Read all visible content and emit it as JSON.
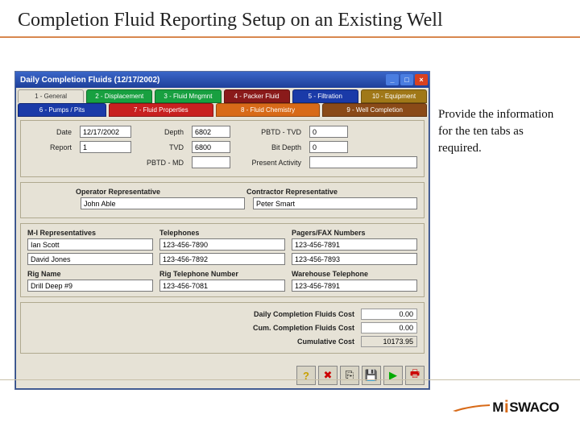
{
  "slide": {
    "title": "Completion Fluid Reporting Setup on an Existing Well"
  },
  "callout": {
    "text": "Provide the information for the ten tabs as required."
  },
  "window": {
    "title": "Daily Completion Fluids (12/17/2002)"
  },
  "tabs": {
    "row1": [
      {
        "label": "1 - General",
        "active": true
      },
      {
        "label": "2 - Displacement"
      },
      {
        "label": "3 - Fluid Mngmnt"
      },
      {
        "label": "4 - Packer Fluid"
      },
      {
        "label": "5 - Filtration"
      },
      {
        "label": "10 - Equipment"
      }
    ],
    "row2": [
      {
        "label": "6 - Pumps / Pits"
      },
      {
        "label": "7 - Fluid Properties"
      },
      {
        "label": "8 - Fluid Chemistry"
      },
      {
        "label": "9 - Well Completion"
      }
    ]
  },
  "general": {
    "date_label": "Date",
    "date": "12/17/2002",
    "report_label": "Report",
    "report": "1",
    "depth_label": "Depth",
    "depth": "6802",
    "tvd_label": "TVD",
    "tvd": "6800",
    "pbtd_md_label": "PBTD - MD",
    "pbtd_md": "",
    "pbtd_tvd_label": "PBTD - TVD",
    "pbtd_tvd": "0",
    "bit_depth_label": "Bit Depth",
    "bit_depth": "0",
    "activity_label": "Present Activity",
    "activity": ""
  },
  "reps": {
    "op_label": "Operator Representative",
    "op": "John Able",
    "con_label": "Contractor Representative",
    "con": "Peter Smart"
  },
  "contacts": {
    "mi_label": "M-I Representatives",
    "tel_label": "Telephones",
    "fax_label": "Pagers/FAX Numbers",
    "mi1": "Ian Scott",
    "tel1": "123-456-7890",
    "fax1": "123-456-7891",
    "mi2": "David Jones",
    "tel2": "123-456-7892",
    "fax2": "123-456-7893",
    "rig_label": "Rig Name",
    "rigtel_label": "Rig Telephone Number",
    "wh_label": "Warehouse Telephone",
    "rig": "Drill Deep #9",
    "rigtel": "123-456-7081",
    "wh": "123-456-7891"
  },
  "summary": {
    "daily_label": "Daily Completion Fluids Cost",
    "daily": "0.00",
    "cum_label": "Cum. Completion Fluids Cost",
    "cum": "0.00",
    "cumcost_label": "Cumulative Cost",
    "cumcost": "10173.95"
  },
  "toolbar": {
    "help": "?",
    "del": "✖",
    "copy": "⎘",
    "save": "💾",
    "next": "▶",
    "print": "🖶"
  },
  "logo": {
    "brand1": "M",
    "brand2": "SWACO"
  }
}
